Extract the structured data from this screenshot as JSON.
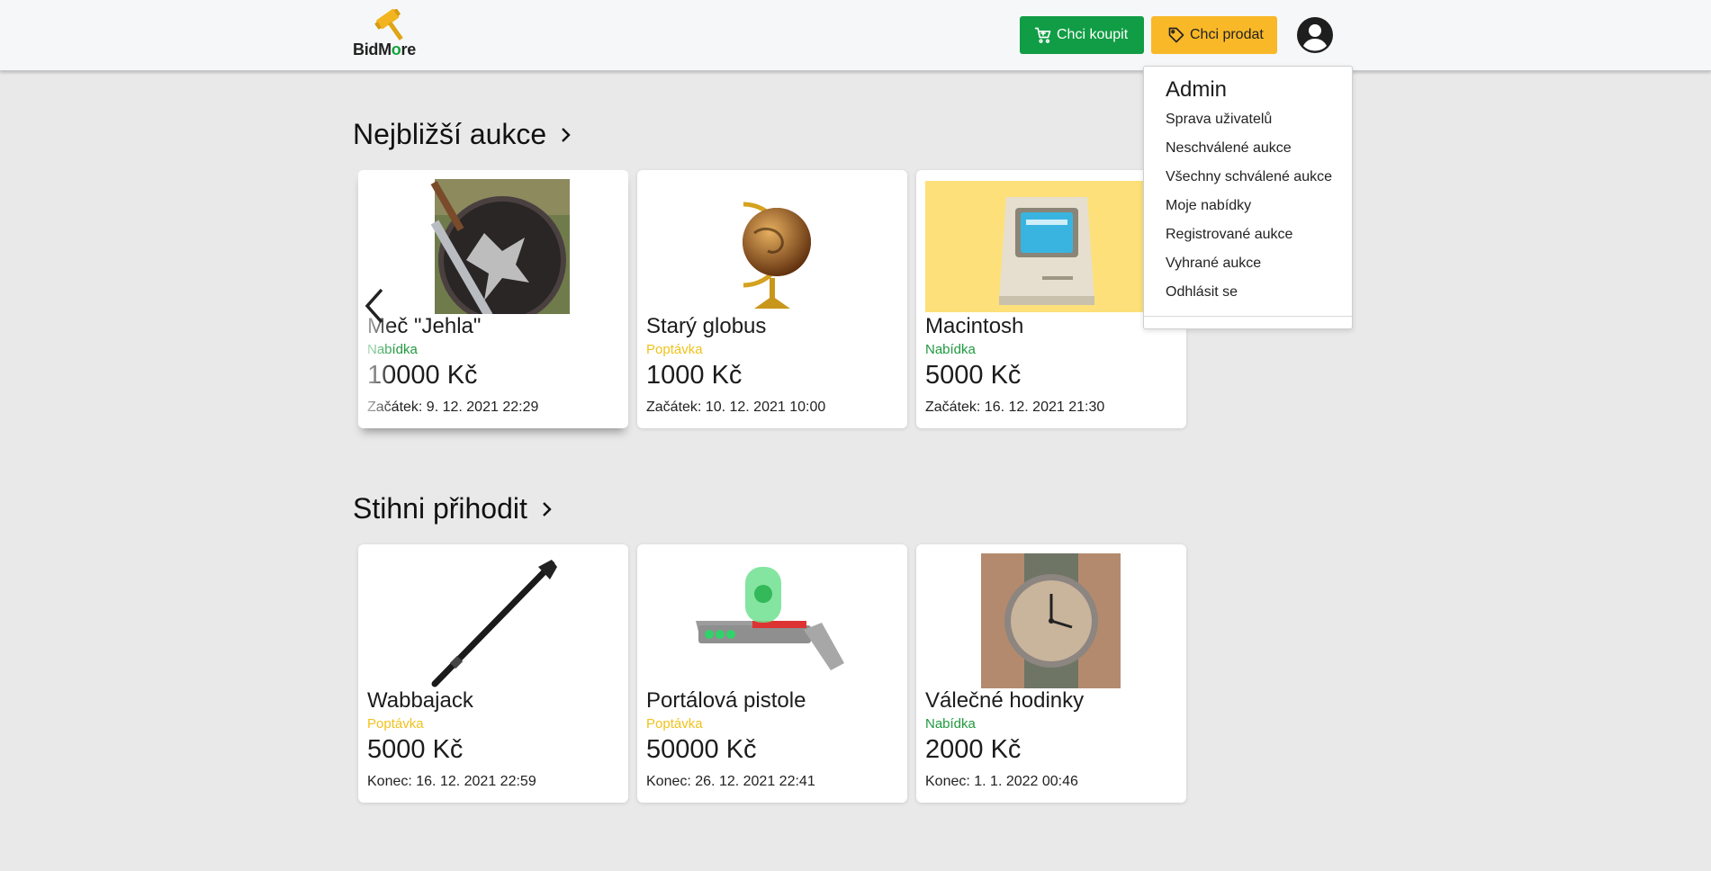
{
  "header": {
    "logo_text_before": "BidM",
    "logo_text_o": "o",
    "logo_text_after": "re",
    "buy_label": "Chci koupit",
    "sell_label": "Chci prodat"
  },
  "colors": {
    "buy_button": "#119d45",
    "sell_button": "#f9b828",
    "offer": "#1f9a3f",
    "demand": "#f0c21d",
    "background": "#e9e9e9"
  },
  "icons": {
    "buy": "cart-icon",
    "sell": "tag-icon",
    "profile": "account-circle-icon",
    "section_more": "chevron-right-icon",
    "carousel_prev": "chevron-left-icon"
  },
  "sections": {
    "nearest": {
      "title": "Nejbližší aukce",
      "cards": [
        {
          "title": "Meč \"Jehla\"",
          "type": "Nabídka",
          "type_kind": "offer",
          "price": "10000 Kč",
          "date": "Začátek: 9. 12. 2021 22:29",
          "image": "sword-shield-image"
        },
        {
          "title": "Starý globus",
          "type": "Poptávka",
          "type_kind": "demand",
          "price": "1000 Kč",
          "date": "Začátek: 10. 12. 2021 10:00",
          "image": "globe-image"
        },
        {
          "title": "Macintosh",
          "type": "Nabídka",
          "type_kind": "offer",
          "price": "5000 Kč",
          "date": "Začátek: 16. 12. 2021 21:30",
          "image": "macintosh-image"
        }
      ]
    },
    "last_chance": {
      "title": "Stihni přihodit",
      "cards": [
        {
          "title": "Wabbajack",
          "type": "Poptávka",
          "type_kind": "demand",
          "price": "5000 Kč",
          "date": "Konec: 16. 12. 2021 22:59",
          "image": "staff-image"
        },
        {
          "title": "Portálová pistole",
          "type": "Poptávka",
          "type_kind": "demand",
          "price": "50000 Kč",
          "date": "Konec: 26. 12. 2021 22:41",
          "image": "portal-gun-image"
        },
        {
          "title": "Válečné hodinky",
          "type": "Nabídka",
          "type_kind": "offer",
          "price": "2000 Kč",
          "date": "Konec: 1. 1. 2022 00:46",
          "image": "wristwatch-image"
        }
      ]
    }
  },
  "user_menu": {
    "title": "Admin",
    "items": [
      "Sprava uživatelů",
      "Neschválené aukce",
      "Všechny schválené aukce",
      "Moje nabídky",
      "Registrované aukce",
      "Vyhrané aukce",
      "Odhlásit se"
    ]
  }
}
